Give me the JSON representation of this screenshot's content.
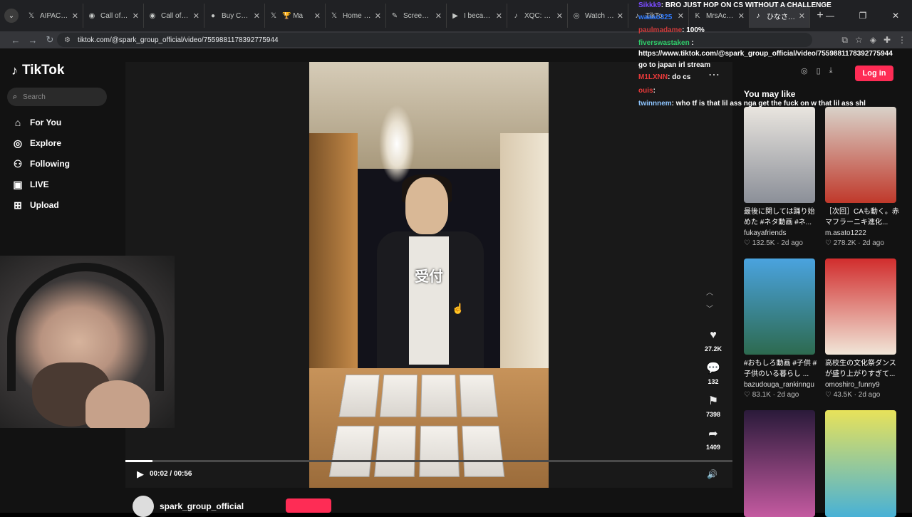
{
  "browser": {
    "tabs": [
      {
        "icon": "x-icon",
        "glyph": "𝕏",
        "title": "AIPAC - Se"
      },
      {
        "icon": "steam-icon",
        "glyph": "◉",
        "title": "Call of Dut"
      },
      {
        "icon": "steam-icon",
        "glyph": "◉",
        "title": "Call of Dut"
      },
      {
        "icon": "dot-icon",
        "glyph": "●",
        "title": "Buy COD E"
      },
      {
        "icon": "x-icon",
        "glyph": "𝕏",
        "title": "🏆 Ma"
      },
      {
        "icon": "x-icon",
        "glyph": "𝕏",
        "title": "Home / X"
      },
      {
        "icon": "pen-icon",
        "glyph": "✎",
        "title": "Screensho"
      },
      {
        "icon": "youtube-icon",
        "glyph": "▶",
        "title": "I became"
      },
      {
        "icon": "tiktok-icon",
        "glyph": "♪",
        "title": "XQC: Diner"
      },
      {
        "icon": "watch-icon",
        "glyph": "◎",
        "title": "Watch \"M"
      },
      {
        "icon": "tiktok-icon",
        "glyph": "♪",
        "title": "TikTo"
      },
      {
        "icon": "kick-icon",
        "glyph": "K",
        "title": "MrsAcme"
      },
      {
        "icon": "tiktok-icon",
        "glyph": "♪",
        "title": "ひなさん美"
      }
    ],
    "url": "tiktok.com/@spark_group_official/video/7559881178392775944"
  },
  "sidebar": {
    "brand": "TikTok",
    "search_placeholder": "Search",
    "items": [
      {
        "label": "For You",
        "icon": "home-icon"
      },
      {
        "label": "Explore",
        "icon": "compass-icon"
      },
      {
        "label": "Following",
        "icon": "user-icon"
      },
      {
        "label": "LIVE",
        "icon": "live-icon"
      },
      {
        "label": "Upload",
        "icon": "upload-icon"
      }
    ]
  },
  "video": {
    "overlay_text": "受付",
    "time": "00:02 / 00:56",
    "progress": 0.045,
    "likes": "27.2K",
    "comments": "132",
    "saves": "7398",
    "shares": "1409",
    "author": "spark_group_official"
  },
  "right_panel": {
    "login": "Log in",
    "you_may_like": "You may like",
    "items": [
      {
        "caption": "最後に関しては踊り始めた #ネタ動画 #ネ...",
        "user": "fukayafriends",
        "likes": "132.5K",
        "ago": "2d ago",
        "bg": "linear-gradient(180deg,#e9e5df,#8b8f98)"
      },
      {
        "caption": "［次回］CAも動く。赤マフラーニキ進化...",
        "user": "m.asato1222",
        "likes": "278.2K",
        "ago": "2d ago",
        "bg": "linear-gradient(180deg,#d9d2c9,#c0392b)"
      },
      {
        "caption": "#おもしろ動画 #子供 #子供のいる暮らし ...",
        "user": "bazudouga_rankinngu",
        "likes": "83.1K",
        "ago": "2d ago",
        "bg": "linear-gradient(180deg,#4aa3df,#2d6a4f)"
      },
      {
        "caption": "高校生の文化祭ダンスが盛り上がりすぎて...",
        "user": "omoshiro_funny9",
        "likes": "43.5K",
        "ago": "2d ago",
        "bg": "linear-gradient(180deg,#d12d2d,#f1e6d8)"
      },
      {
        "caption": "",
        "user": "",
        "likes": "",
        "ago": "",
        "bg": "linear-gradient(180deg,#2a1a3a,#c45aa0)"
      },
      {
        "caption": "",
        "user": "",
        "likes": "",
        "ago": "",
        "bg": "linear-gradient(180deg,#e8e25a,#48b1d6)"
      }
    ]
  },
  "chat": [
    {
      "user": "Sikkk9",
      "color": "#7a4bff",
      "msg": ": BRO JUST HOP ON CS WITHOUT A CHALLENGE"
    },
    {
      "user": "waaao325",
      "color": "#2f7bff",
      "msg": ""
    },
    {
      "user": "paulmadame",
      "color": "#cc3b3b",
      "msg": ": 100%"
    },
    {
      "user": "fiverswastaken",
      "color": "#2fcc6a",
      "msg": " :"
    },
    {
      "user": "",
      "color": "#ffffff",
      "msg": "https://www.tiktok.com/@spark_group_official/video/7559881178392775944"
    },
    {
      "user": "",
      "color": "#ffffff",
      "msg": "go to japan irl stream"
    },
    {
      "user": "M1LXNN",
      "color": "#e83a3a",
      "msg": ": do cs"
    },
    {
      "user": "ouis",
      "color": "#e83a3a",
      "msg": ":"
    },
    {
      "user": "twinnnem",
      "color": "#8ec5ff",
      "msg": ": who tf is that lil ass nga get the fuck on w that lil ass shl"
    }
  ]
}
